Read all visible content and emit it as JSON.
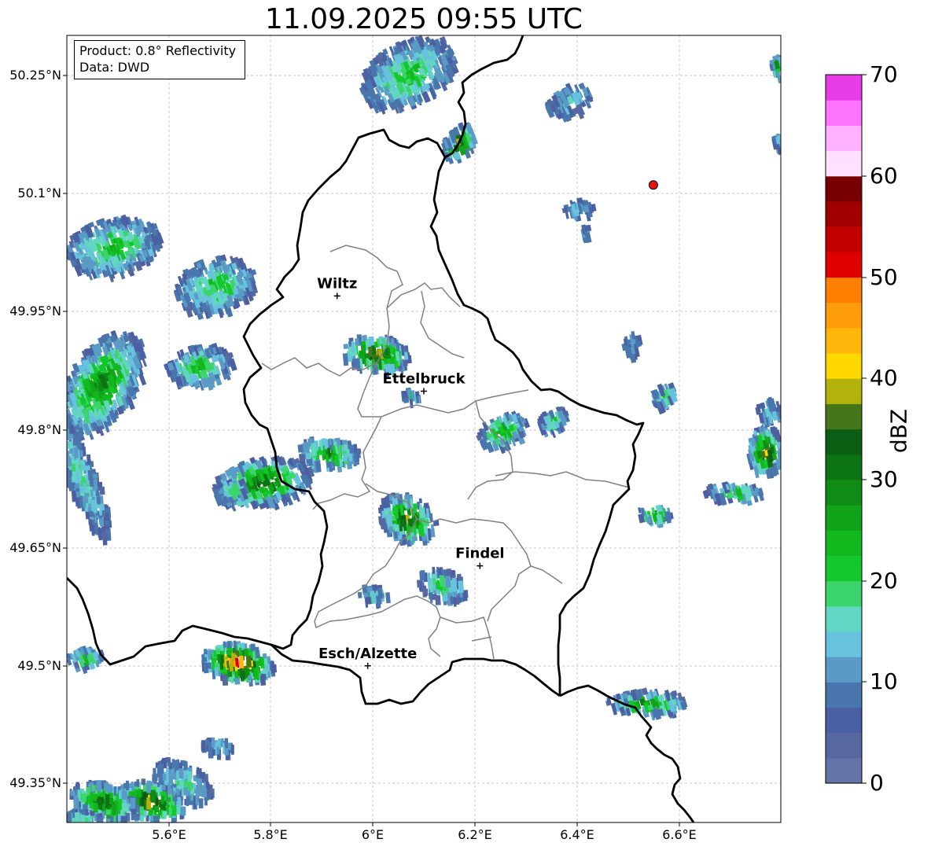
{
  "title": "11.09.2025 09:55 UTC",
  "info": {
    "line1": "Product: 0.8° Reflectivity",
    "line2": "Data: DWD"
  },
  "lat_ticks": [
    "50.25°N",
    "50.1°N",
    "49.95°N",
    "49.8°N",
    "49.65°N",
    "49.5°N",
    "49.35°N"
  ],
  "lon_ticks": [
    "5.6°E",
    "5.8°E",
    "6°E",
    "6.2°E",
    "6.4°E",
    "6.6°E"
  ],
  "colorbar": {
    "label": "dBZ",
    "ticks": [
      "0",
      "10",
      "20",
      "30",
      "40",
      "50",
      "60",
      "70"
    ],
    "range": [
      0,
      70
    ],
    "step_dbz": 2.5,
    "colors": [
      "#6574a8",
      "#56689f",
      "#4a60a2",
      "#4a76ae",
      "#5a9bc6",
      "#66c2dd",
      "#62d6c2",
      "#3cd46c",
      "#12c82a",
      "#12b81e",
      "#11a41a",
      "#0f8c14",
      "#0c7414",
      "#0c5e14",
      "#46761a",
      "#b2b20a",
      "#ffd800",
      "#ffb60a",
      "#ff9c0a",
      "#ff8000",
      "#e00000",
      "#c20000",
      "#a20000",
      "#780000",
      "#ffe0ff",
      "#ffb2ff",
      "#ff74ff",
      "#e83ce8"
    ]
  },
  "cities": [
    {
      "name": "Wiltz",
      "lon": 5.93,
      "lat": 49.969
    },
    {
      "name": "Ettelbruck",
      "lon": 6.1,
      "lat": 49.848
    },
    {
      "name": "Findel",
      "lon": 6.21,
      "lat": 49.626
    },
    {
      "name": "Esch/Alzette",
      "lon": 5.99,
      "lat": 49.499
    }
  ],
  "marker": {
    "lon": 6.55,
    "lat": 50.11,
    "color": "#e81010"
  },
  "map_extent": {
    "lon": [
      5.4,
      6.8
    ],
    "lat": [
      49.3,
      50.3
    ]
  }
}
